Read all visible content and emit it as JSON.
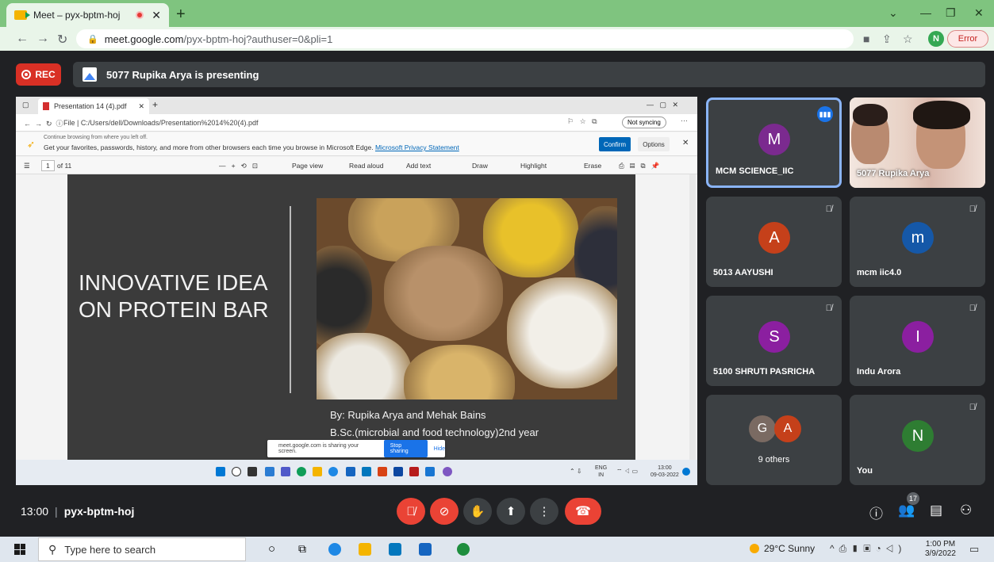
{
  "browser": {
    "tab_title": "Meet – pyx-bptm-hoj",
    "url_host": "meet.google.com",
    "url_path": "/pyx-bptm-hoj?authuser=0&pli=1",
    "profile_initial": "N",
    "error_label": "Error"
  },
  "meet": {
    "rec_label": "REC",
    "presenting_text": "5077 Rupika Arya is presenting",
    "time": "13:00",
    "meeting_code": "pyx-bptm-hoj",
    "participant_count": "17"
  },
  "shared_screen": {
    "pdf_tab": "Presentation 14 (4).pdf",
    "pdf_path": "File  |  C:/Users/dell/Downloads/Presentation%2014%20(4).pdf",
    "not_syncing": "Not syncing",
    "infobar_line1": "Continue browsing from where you left off.",
    "infobar_line2": "Get your favorites, passwords, history, and more from other browsers each time you browse in Microsoft Edge.",
    "infobar_link": "Microsoft Privacy Statement",
    "confirm": "Confirm",
    "options": "Options",
    "page_num": "1",
    "page_total": "of 11",
    "toolbar": {
      "page_view": "Page view",
      "read_aloud": "Read aloud",
      "add_text": "Add text",
      "draw": "Draw",
      "highlight": "Highlight",
      "erase": "Erase"
    },
    "slide_title": "INNOVATIVE IDEA ON PROTEIN BAR",
    "byline1": "By: Rupika Arya and Mehak Bains",
    "byline2": "B.Sc.(microbial and food technology)2nd year",
    "share_notice": "meet.google.com is sharing your screen.",
    "stop_sharing": "Stop sharing",
    "hide": "Hide",
    "remote_lang": "ENG",
    "remote_lang2": "IN",
    "remote_time": "13:00",
    "remote_date": "09-03-2022"
  },
  "participants": [
    {
      "name": "MCM SCIENCE_IIC",
      "initial": "M",
      "color": "#7b2a8f"
    },
    {
      "name": "5077 Rupika Arya"
    },
    {
      "name": "5013 AAYUSHI",
      "initial": "A",
      "color": "#c5401a"
    },
    {
      "name": "mcm iic4.0",
      "initial": "m",
      "color": "#1558a8"
    },
    {
      "name": "5100 SHRUTI PASRICHA",
      "initial": "S",
      "color": "#8b1fa0"
    },
    {
      "name": "Indu Arora",
      "initial": "I",
      "color": "#8b1fa0"
    },
    {
      "name": "9 others",
      "initials": [
        "G",
        "A"
      ],
      "colors": [
        "#7a6a62",
        "#c5401a"
      ]
    },
    {
      "name": "You",
      "initial": "N",
      "color": "#2e7d32"
    }
  ],
  "taskbar": {
    "search_placeholder": "Type here to search",
    "weather": "29°C  Sunny",
    "time": "1:00 PM",
    "date": "3/9/2022"
  }
}
